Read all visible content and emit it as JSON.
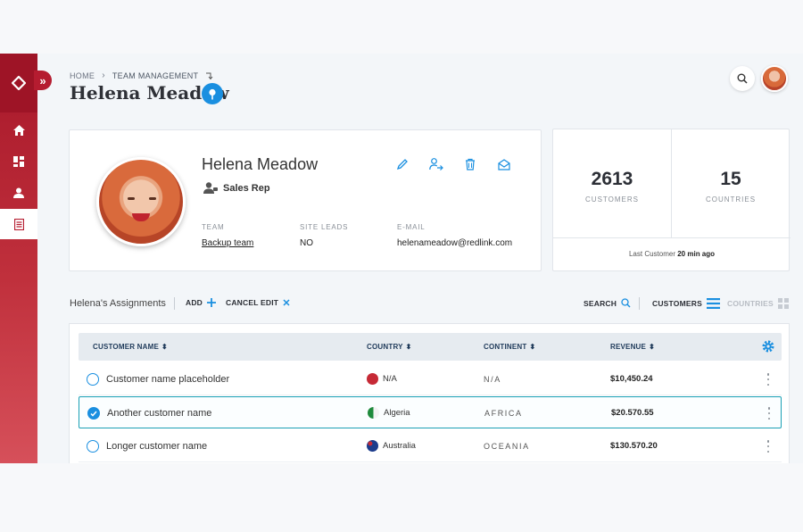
{
  "breadcrumb": {
    "home": "HOME",
    "current": "TEAM MANAGEMENT"
  },
  "page": {
    "title": "Helena Meadow"
  },
  "profile": {
    "name": "Helena Meadow",
    "role": "Sales Rep",
    "fields": [
      {
        "label": "TEAM",
        "value": "Backup team"
      },
      {
        "label": "SITE LEADS",
        "value": "NO"
      },
      {
        "label": "E-MAIL",
        "value": "helenameadow@redlink.com"
      }
    ]
  },
  "stats": {
    "customers": {
      "value": "2613",
      "caption": "CUSTOMERS"
    },
    "countries": {
      "value": "15",
      "caption": "COUNTRIES"
    },
    "last_customer_label": "Last Customer",
    "last_customer_time": "20 min ago"
  },
  "toolbar": {
    "title": "Helena's Assignments",
    "add": "ADD",
    "cancel_edit": "CANCEL EDIT",
    "search": "SEARCH",
    "customers": "CUSTOMERS",
    "countries": "COUNTRIES"
  },
  "table": {
    "headers": {
      "name": "CUSTOMER NAME",
      "country": "COUNTRY",
      "continent": "CONTINENT",
      "revenue": "REVENUE"
    },
    "rows": [
      {
        "name": "Customer name placeholder",
        "country": "N/A",
        "continent": "N/A",
        "revenue": "$10,450.24",
        "selected": false,
        "flag_color": "#c62a36"
      },
      {
        "name": "Another customer name",
        "country": "Algeria",
        "continent": "AFRICA",
        "revenue": "$20.570.55",
        "selected": true,
        "flag_color": "#1f8a3c"
      },
      {
        "name": "Longer customer name",
        "country": "Australia",
        "continent": "OCEANIA",
        "revenue": "$130.570.20",
        "selected": false,
        "flag_color": "#1c3c8c"
      }
    ]
  },
  "colors": {
    "brand": "#b51c30",
    "accent": "#1a8fe0",
    "selected_border": "#1aa0b5"
  }
}
